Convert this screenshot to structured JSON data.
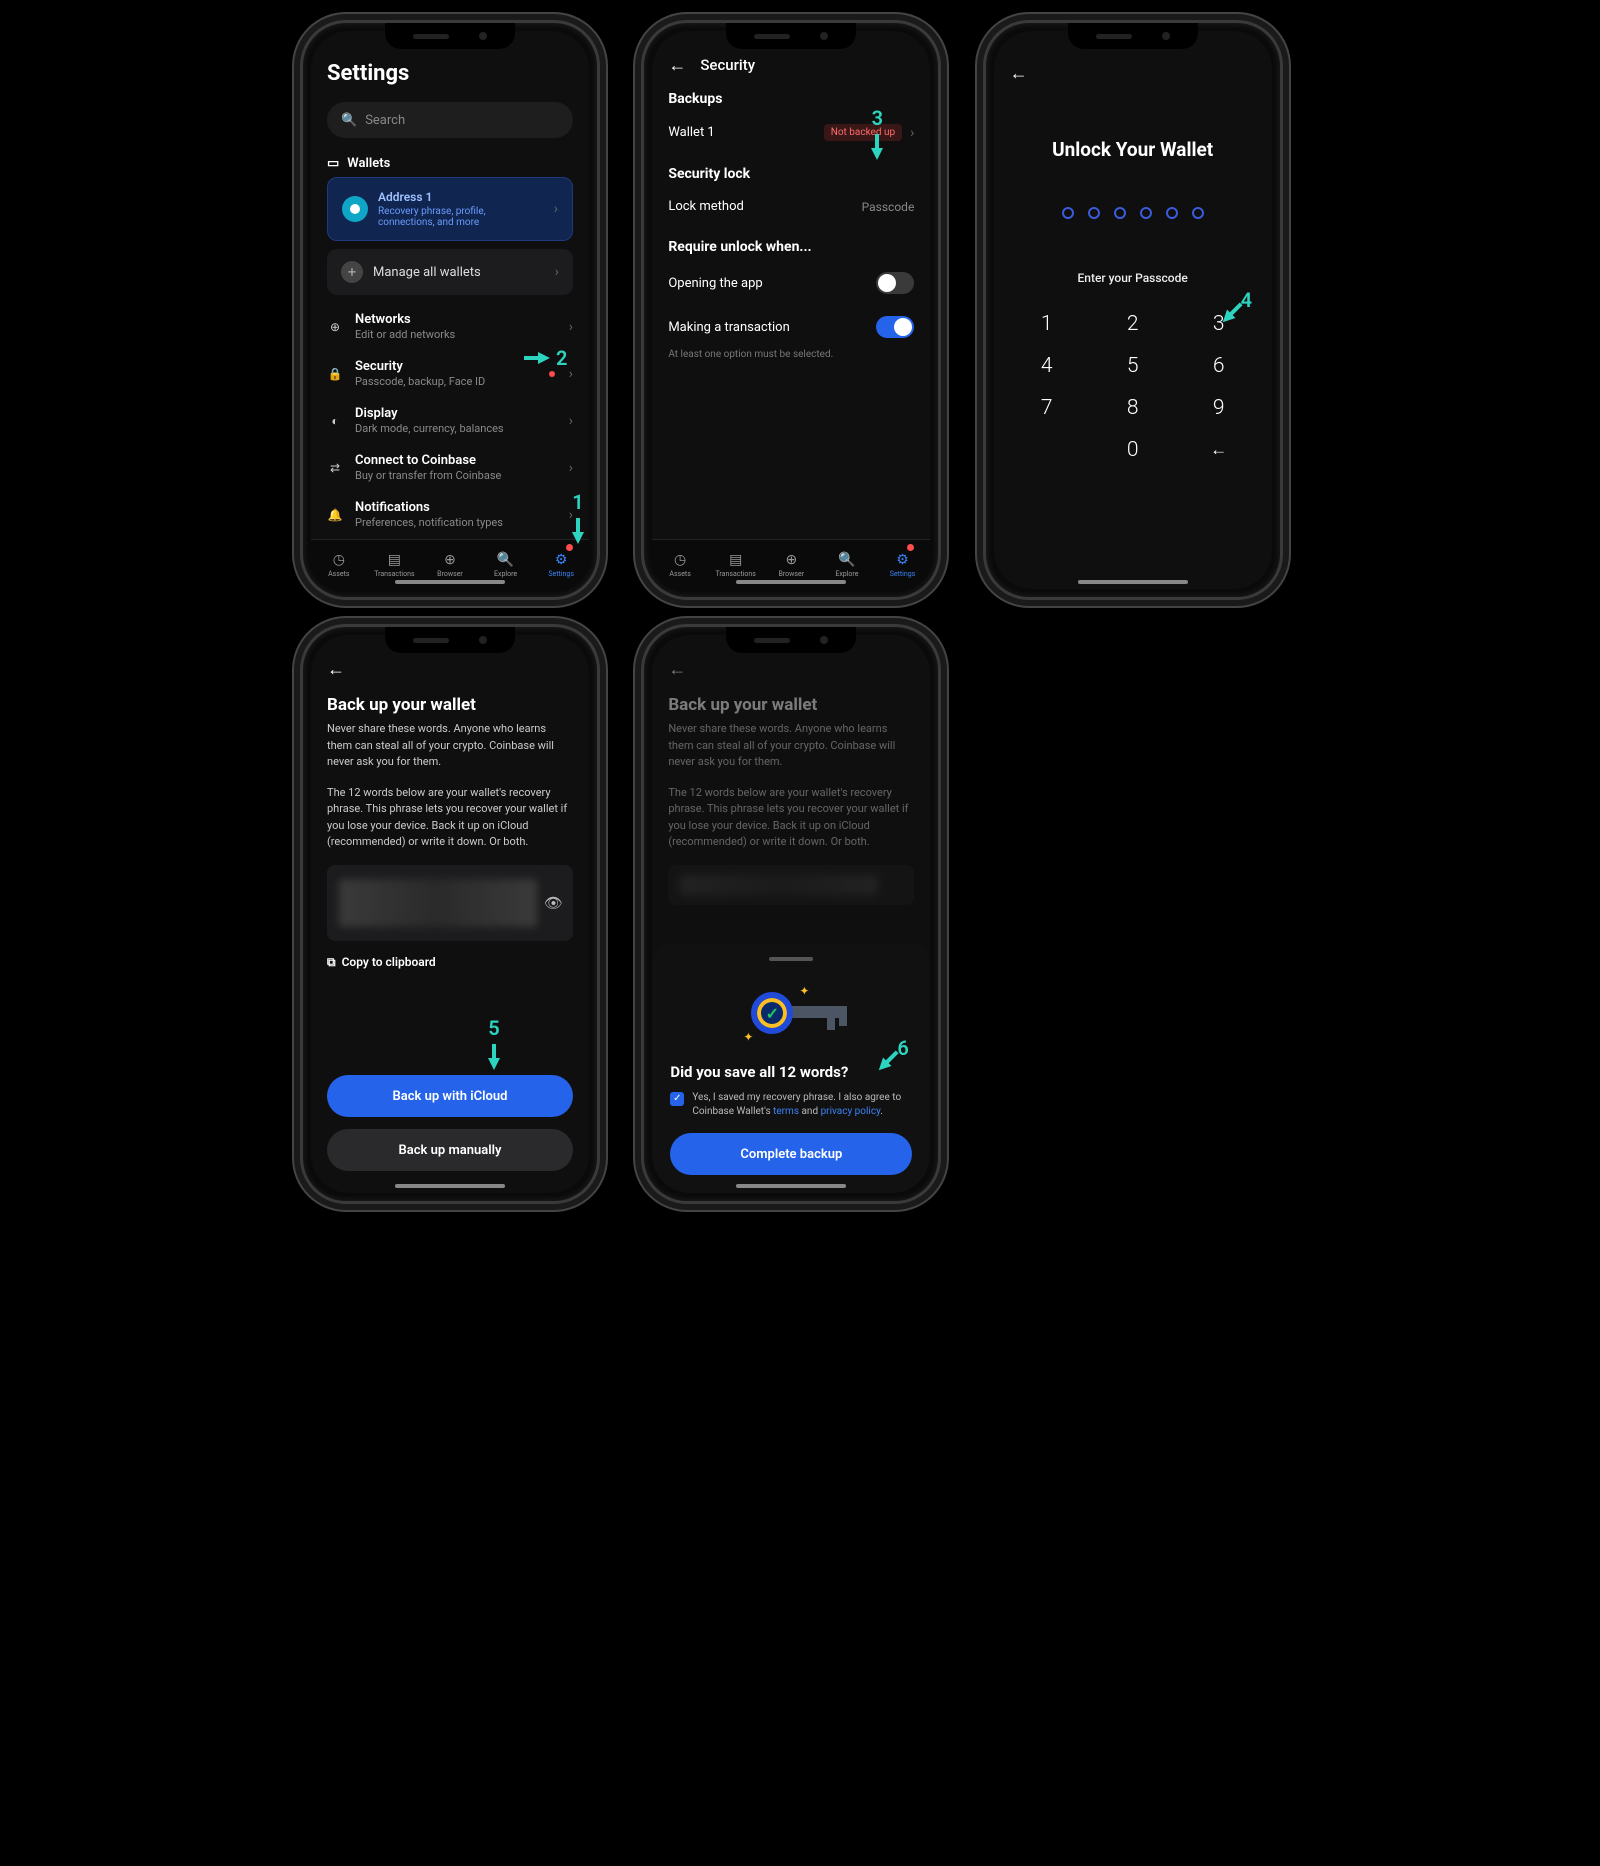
{
  "callouts": {
    "c1": "1",
    "c2": "2",
    "c3": "3",
    "c4": "4",
    "c5": "5",
    "c6": "6"
  },
  "tabs": {
    "assets": "Assets",
    "transactions": "Transactions",
    "browser": "Browser",
    "explore": "Explore",
    "settings": "Settings"
  },
  "screen1": {
    "title": "Settings",
    "search_placeholder": "Search",
    "wallets_label": "Wallets",
    "address_title": "Address 1",
    "address_sub": "Recovery phrase, profile, connections, and more",
    "manage": "Manage all wallets",
    "networks_t": "Networks",
    "networks_s": "Edit or add networks",
    "security_t": "Security",
    "security_s": "Passcode, backup, Face ID",
    "display_t": "Display",
    "display_s": "Dark mode, currency, balances",
    "connect_t": "Connect to Coinbase",
    "connect_s": "Buy or transfer from Coinbase",
    "notif_t": "Notifications",
    "notif_s": "Preferences, notification types"
  },
  "screen2": {
    "title": "Security",
    "backups": "Backups",
    "wallet": "Wallet 1",
    "wallet_status": "Not backed up",
    "lock_h": "Security lock",
    "lock_method": "Lock method",
    "lock_method_v": "Passcode",
    "require": "Require unlock when...",
    "opening": "Opening the app",
    "opening_on": false,
    "transaction": "Making a transaction",
    "transaction_on": true,
    "hint": "At least one option must be selected."
  },
  "screen3": {
    "title": "Unlock Your Wallet",
    "enter": "Enter your Passcode",
    "keys": [
      "1",
      "2",
      "3",
      "4",
      "5",
      "6",
      "7",
      "8",
      "9",
      "",
      "0",
      "←"
    ]
  },
  "screen4": {
    "title": "Back up your wallet",
    "p1": "Never share these words. Anyone who learns them can steal all of your crypto. Coinbase will never ask you for them.",
    "p2": "The 12 words below are your wallet's recovery phrase. This phrase lets you recover your wallet if you lose your device. Back it up on iCloud (recommended) or write it down. Or both.",
    "copy": "Copy to clipboard",
    "btn_icloud": "Back up with iCloud",
    "btn_manual": "Back up manually"
  },
  "screen5": {
    "sheet_title": "Did you save all 12 words?",
    "consent_pre": "Yes, I saved my recovery phrase. I also agree to Coinbase Wallet's ",
    "terms": "terms",
    "and": " and ",
    "privacy": "privacy policy",
    "complete": "Complete backup"
  }
}
